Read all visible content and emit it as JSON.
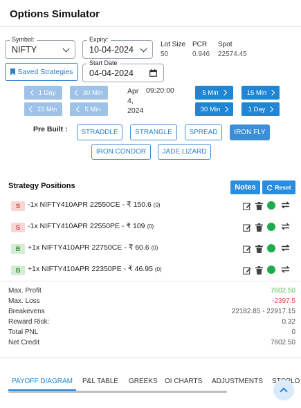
{
  "header": {
    "title": "Options Simulator"
  },
  "form": {
    "symbol": {
      "label": "Symbol:",
      "value": "NIFTY"
    },
    "expiry": {
      "label": "Expiry:",
      "value": "10-04-2024"
    },
    "start_date": {
      "label": "Start Date",
      "value": "04-04-2024"
    },
    "lot_size": {
      "label": "Lot Size",
      "value": "50"
    },
    "pcr": {
      "label": "PCR",
      "value": "0.946"
    },
    "spot": {
      "label": "Spot",
      "value": "22574.45"
    },
    "saved_strategies": "Saved Strategies"
  },
  "time_nav": {
    "back_1day": "1 Day",
    "back_30min": "30 Min",
    "back_15min": "15 Min",
    "back_5min": "5 Min",
    "date_lines": [
      "Apr",
      "4,",
      "2024"
    ],
    "time": "09:20:00",
    "fwd_5min": "5 Min",
    "fwd_15min": "15 Min",
    "fwd_30min": "30 Min",
    "fwd_1day": "1 Day"
  },
  "prebuilt": {
    "label": "Pre Built :",
    "items": [
      "STRADDLE",
      "STRANGLE",
      "SPREAD",
      "IRON FLY",
      "IRON CONDOR",
      "JADE LIZARD"
    ],
    "active": "IRON FLY"
  },
  "positions": {
    "title": "Strategy Positions",
    "notes": "Notes",
    "reset": "Reset",
    "legs": [
      {
        "side": "S",
        "text": "-1x NIFTY410APR 22550CE - ₹ 150.6",
        "suffix": "(0)"
      },
      {
        "side": "S",
        "text": "-1x NIFTY410APR 22550PE - ₹ 109",
        "suffix": "(0)"
      },
      {
        "side": "B",
        "text": "+1x NIFTY410APR 22750CE - ₹ 60.6",
        "suffix": "(0)"
      },
      {
        "side": "B",
        "text": "+1x NIFTY410APR 22350PE - ₹ 46.95",
        "suffix": "(0)"
      }
    ]
  },
  "stats": [
    {
      "label": "Max. Profit",
      "value": "7602.50",
      "color": "#5bc05b"
    },
    {
      "label": "Max. Loss",
      "value": "-2397.5",
      "color": "#d9534f"
    },
    {
      "label": "Breakevens",
      "value": "22182.85 - 22917.15",
      "color": "#555555"
    },
    {
      "label": "Reward Risk:",
      "value": "0.32",
      "color": "#555555"
    },
    {
      "label": "Total PNL",
      "value": "0",
      "color": "#555555"
    },
    {
      "label": "Net Credit",
      "value": "7602.50",
      "color": "#555555"
    }
  ],
  "tabs": [
    "PAYOFF DIAGRAM",
    "P&L TABLE",
    "GREEKS",
    "OI CHARTS",
    "ADJUSTMENTS",
    "STOPLO"
  ],
  "icons": {
    "edit": "pencil-icon",
    "delete": "trash-icon",
    "status": "active-dot-icon",
    "swap": "swap-icon",
    "bookmark": "bookmark-icon",
    "calendar": "calendar-icon",
    "refresh": "refresh-icon",
    "scroll_top": "chevron-up-icon"
  },
  "colors": {
    "accent": "#1f86d6",
    "buy": "#3f8d3f",
    "sell": "#c94b4b",
    "profit": "#5bc05b",
    "loss": "#d9534f"
  }
}
